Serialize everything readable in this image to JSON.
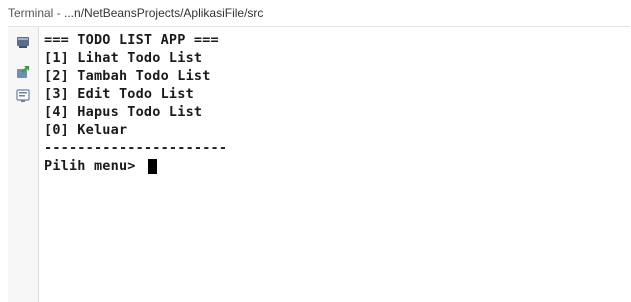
{
  "window": {
    "title_prefix": "Terminal - ",
    "title_path": "...n/NetBeansProjects/AplikasiFile/src"
  },
  "gutter": {
    "buttons": [
      {
        "icon": "stop-icon"
      },
      {
        "icon": "rerun-icon"
      },
      {
        "icon": "options-icon"
      }
    ]
  },
  "console": {
    "lines": [
      "=== TODO LIST APP ===",
      "[1] Lihat Todo List",
      "[2] Tambah Todo List",
      "[3] Edit Todo List",
      "[4] Hapus Todo List",
      "[0] Keluar",
      "----------------------"
    ],
    "prompt": "Pilih menu> "
  }
}
